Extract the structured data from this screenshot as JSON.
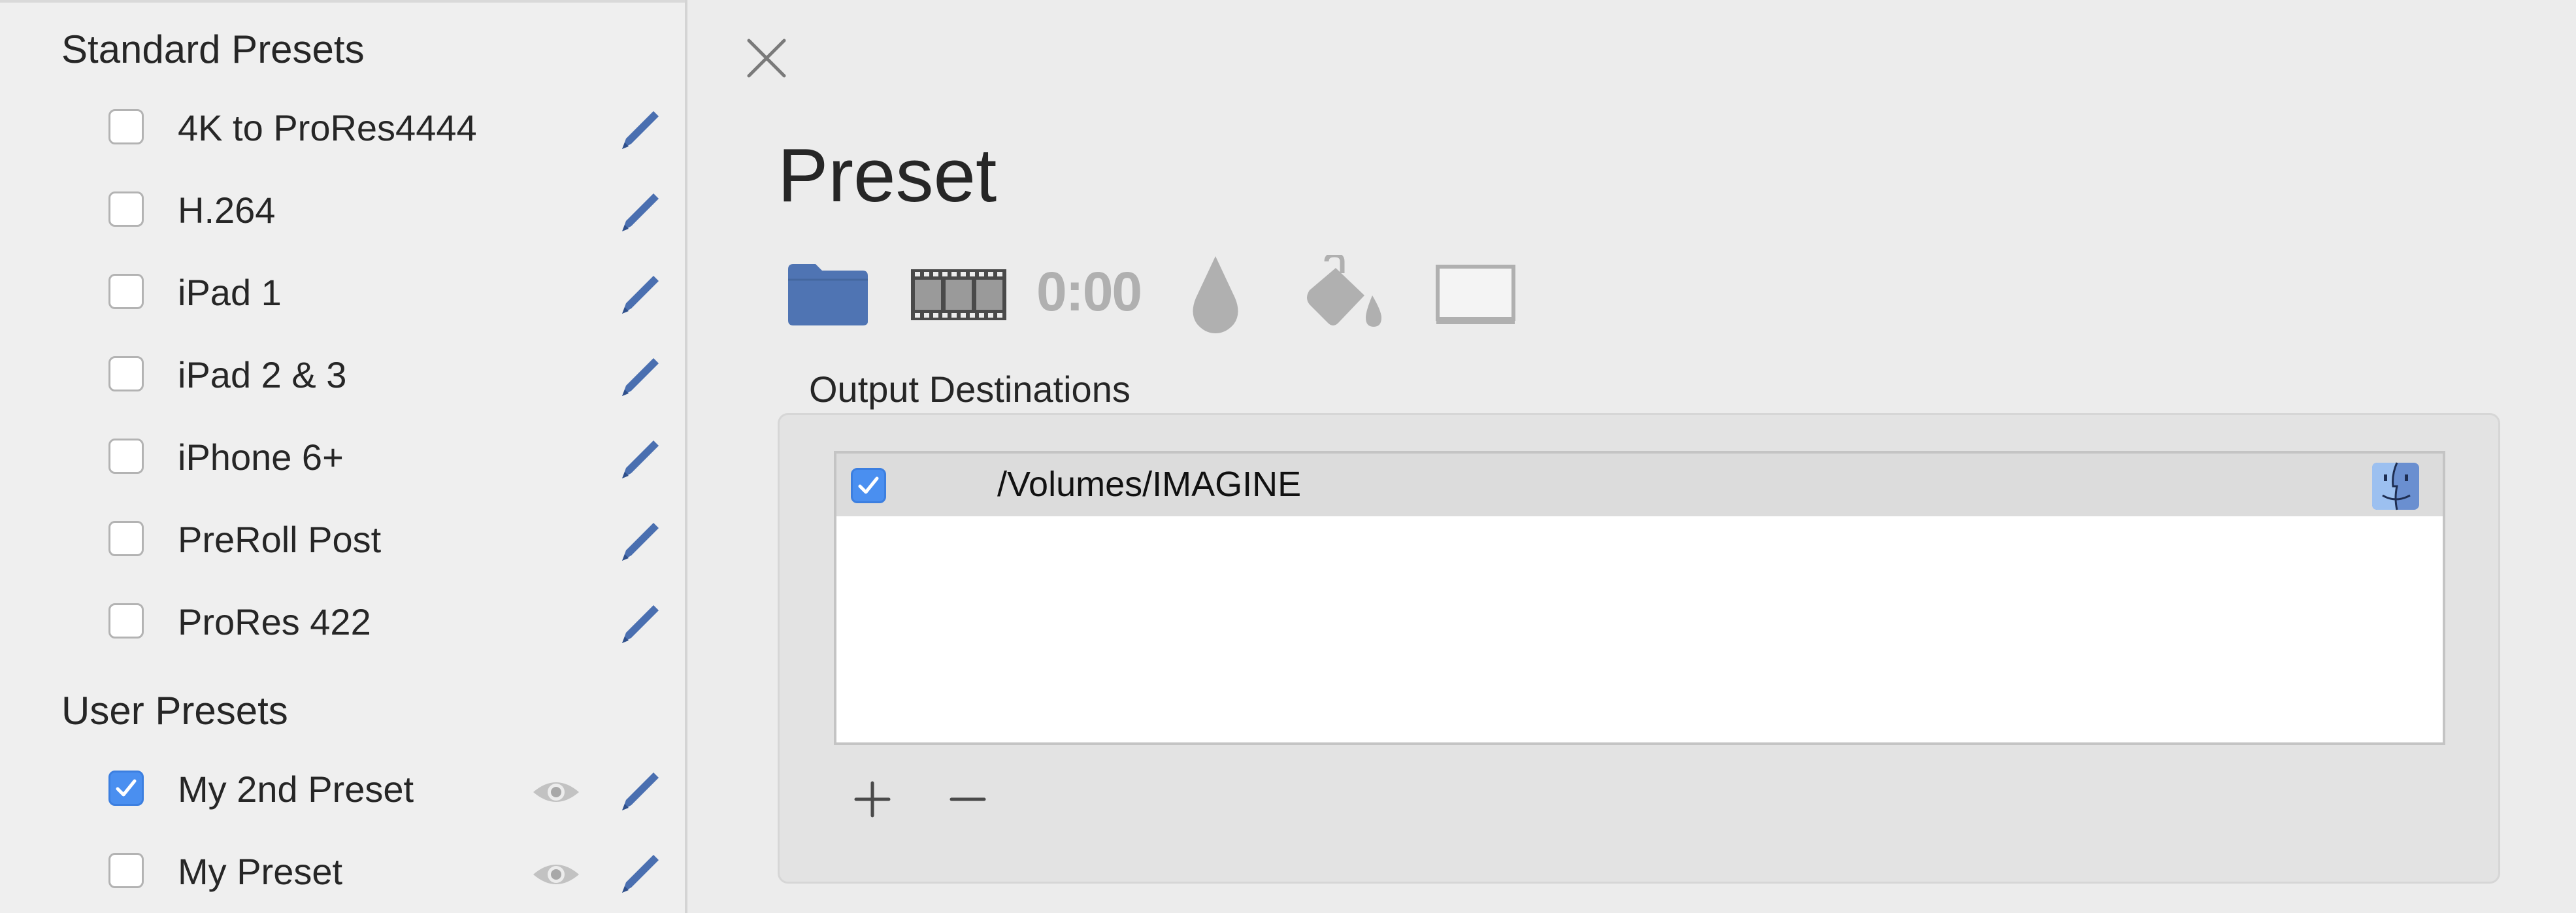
{
  "sidebar": {
    "standard_header": "Standard Presets",
    "standard_items": [
      {
        "label": "4K to ProRes4444",
        "checked": false
      },
      {
        "label": "H.264",
        "checked": false
      },
      {
        "label": "iPad 1",
        "checked": false
      },
      {
        "label": "iPad 2 & 3",
        "checked": false
      },
      {
        "label": "iPhone 6+",
        "checked": false
      },
      {
        "label": "PreRoll Post",
        "checked": false
      },
      {
        "label": "ProRes 422",
        "checked": false
      }
    ],
    "user_header": "User Presets",
    "user_items": [
      {
        "label": "My 2nd Preset",
        "checked": true
      },
      {
        "label": "My Preset",
        "checked": false
      }
    ]
  },
  "main": {
    "title": "Preset",
    "toolbar": {
      "icons": [
        "folder-icon",
        "film-strip-icon",
        "time-icon",
        "drop-icon",
        "paint-bucket-icon",
        "display-icon"
      ],
      "time_label": "0:00"
    },
    "output_destinations": {
      "label": "Output Destinations",
      "rows": [
        {
          "path": "/Volumes/IMAGINE",
          "checked": true
        }
      ]
    }
  },
  "colors": {
    "accent": "#4a8ff0",
    "edit_pencil": "#4a6fb0",
    "folder": "#4f74b3",
    "icon_gray": "#b0b0b0"
  }
}
